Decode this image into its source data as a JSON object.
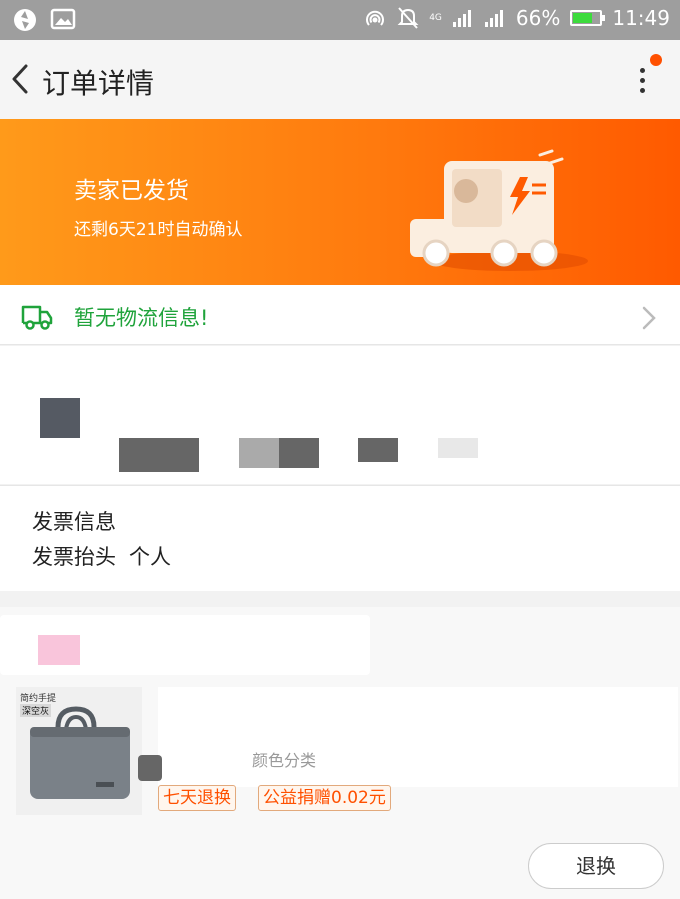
{
  "status_bar": {
    "battery": "66%",
    "time": "11:49",
    "network": "4G",
    "battery_level": 0.66,
    "icons": [
      "app-icon",
      "image-icon",
      "hotspot-icon",
      "mute-icon",
      "signal-icon",
      "signal-icon",
      "battery-icon"
    ]
  },
  "header": {
    "title": "订单详情"
  },
  "banner": {
    "title": "卖家已发货",
    "subtitle": "还剩6天21时自动确认",
    "gradient": [
      "#ff9a1a",
      "#ff5a00"
    ]
  },
  "logistics": {
    "text": "暂无物流信息!"
  },
  "invoice": {
    "title": "发票信息",
    "head_label": "发票抬头",
    "head_value": "个人"
  },
  "product": {
    "thumb_text_1": "简约手提",
    "thumb_text_2": "深空灰",
    "spec_partial": "颜色分类",
    "tags": [
      "七天退换",
      "公益捐赠0.02元"
    ]
  },
  "actions": {
    "return_label": "退换"
  },
  "colors": {
    "accent": "#ff5000",
    "logistics_green": "#1fa33b"
  }
}
